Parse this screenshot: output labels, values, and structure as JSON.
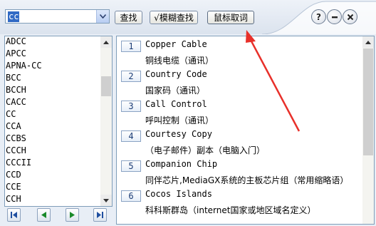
{
  "toolbar": {
    "search_value": "cc",
    "search_button": "查找",
    "fuzzy_button": "√模糊查找",
    "mouse_button": "鼠标取词",
    "help_button": "?"
  },
  "word_list": [
    "ADCC",
    "APCC",
    "APNA-CC",
    "BCC",
    "BCCH",
    "CACC",
    "CC",
    "CCA",
    "CCBS",
    "CCCH",
    "CCCII",
    "CCD",
    "CCE",
    "CCH"
  ],
  "results": [
    {
      "num": "1",
      "en": "Copper Cable",
      "cn": "铜线电缆（通讯）"
    },
    {
      "num": "2",
      "en": "Country Code",
      "cn": "国家码（通讯）"
    },
    {
      "num": "3",
      "en": "Call Control",
      "cn": "呼叫控制（通讯）"
    },
    {
      "num": "4",
      "en": "Courtesy Copy",
      "cn": "（电子邮件）副本（电脑入门）"
    },
    {
      "num": "5",
      "en": "Companion Chip",
      "cn": "同伴芯片,MediaGX系统的主板芯片组（常用缩略语）"
    },
    {
      "num": "6",
      "en": "Cocos Islands",
      "cn": "科科斯群岛（internet国家或地区域名定义）"
    }
  ],
  "colors": {
    "accent": "#2a5ca8",
    "arrow": "#e8302a"
  }
}
